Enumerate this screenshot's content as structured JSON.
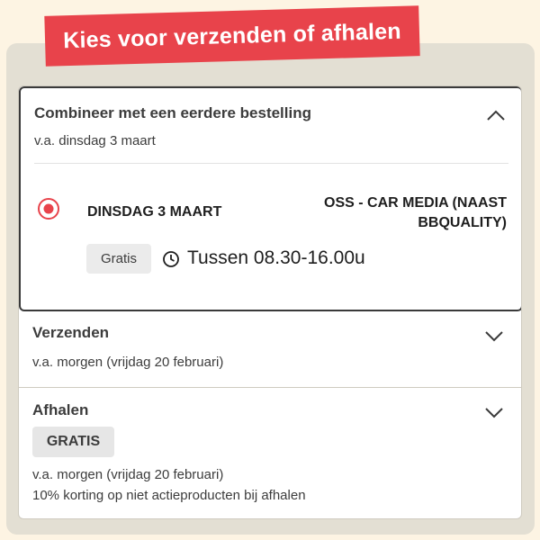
{
  "banner": {
    "title": "Kies voor verzenden of afhalen"
  },
  "options": {
    "combine": {
      "title": "Combineer met een eerdere bestelling",
      "subtitle": "v.a. dinsdag 3 maart",
      "chevron": "chevron-up-icon",
      "selected_slot": {
        "date": "DINSDAG 3 MAART",
        "location": "OSS - CAR MEDIA (NAAST BBQUALITY)",
        "price_badge": "Gratis",
        "time_icon": "clock-icon",
        "time": "Tussen 08.30-16.00u"
      }
    },
    "shipping": {
      "title": "Verzenden",
      "subtitle": "v.a. morgen (vrijdag 20 februari)",
      "chevron": "chevron-down-icon"
    },
    "pickup": {
      "title": "Afhalen",
      "badge": "GRATIS",
      "subtitle": "v.a. morgen (vrijdag 20 februari)",
      "note": "10% korting op niet actieproducten bij afhalen",
      "chevron": "chevron-down-icon"
    }
  },
  "colors": {
    "accent_red": "#e8434b",
    "background": "#fdf4e3",
    "panel_frame": "#e3dfd3",
    "text_dark": "#3c3c3c"
  }
}
